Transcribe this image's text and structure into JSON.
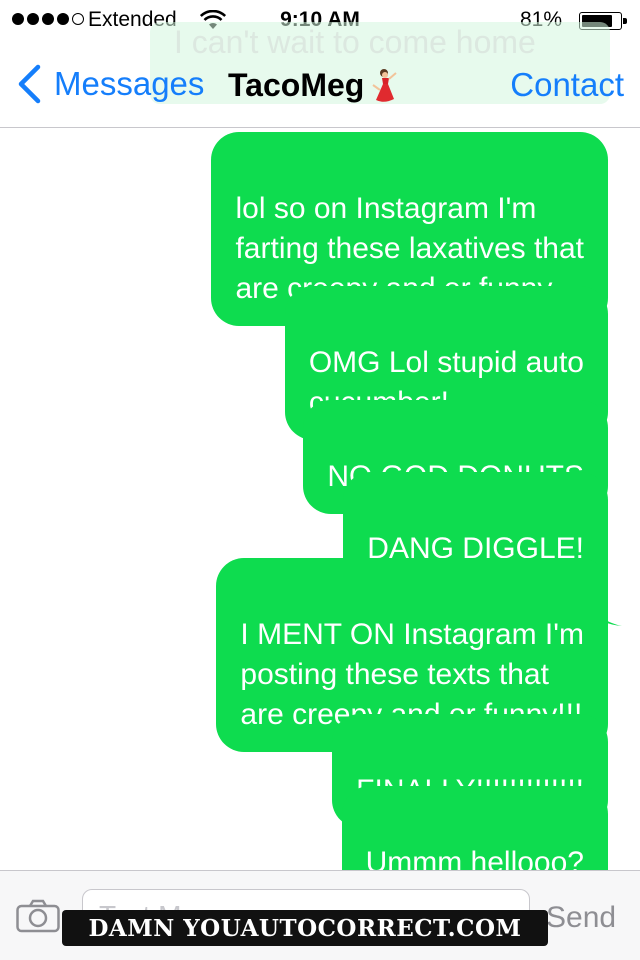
{
  "status_bar": {
    "carrier": "Extended",
    "time": "9:10 AM",
    "battery_percent": "81%",
    "battery_level": 0.81,
    "signal_bars_filled": 4,
    "signal_bars_total": 5,
    "icons": [
      "wifi-icon",
      "battery-icon"
    ]
  },
  "banner": {
    "text": "I can't wait to come home"
  },
  "nav": {
    "back_label": "Messages",
    "title": "TacoMeg",
    "title_emoji": "dancer-emoji",
    "contact_label": "Contact",
    "accent_color": "#157efb"
  },
  "messages": [
    {
      "text": "lol so on Instagram I'm\nfarting these laxatives that\nare creepy and or funny.",
      "sender": "me"
    },
    {
      "text": "OMG Lol stupid auto\ncucumber!",
      "sender": "me"
    },
    {
      "text": "NO GOD DONUTS",
      "sender": "me"
    },
    {
      "text": "DANG DIGGLE!",
      "sender": "me"
    },
    {
      "text": "I MENT ON Instagram I'm\nposting these texts that\nare creepy and or funny!!!",
      "sender": "me"
    },
    {
      "text": "FINALLY!!!!!!!!!!!!!",
      "sender": "me"
    },
    {
      "text": "Ummm hellooo?",
      "sender": "me"
    }
  ],
  "bubble_color": "#0edc4f",
  "input_bar": {
    "placeholder": "Text Message",
    "send_label": "Send"
  },
  "watermark": {
    "text": "DAMN YOUAUTOCORRECT.COM"
  }
}
